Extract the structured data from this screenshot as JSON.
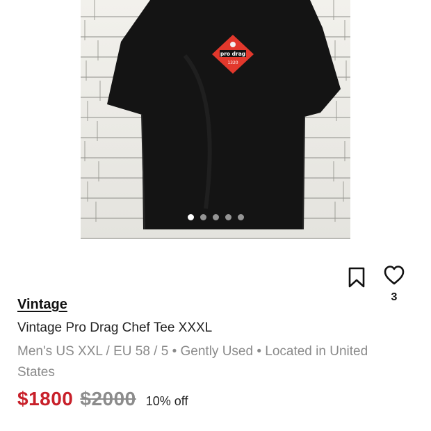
{
  "photo": {
    "patch_text_top": "pro drag",
    "patch_text_bottom": "1320",
    "carousel_count": 5,
    "carousel_active": 1,
    "wall_color": "#e9e8e3",
    "shirt_color": "#141414",
    "patch_color": "#e2382c"
  },
  "actions": {
    "bookmark_icon": "bookmark-icon",
    "like_icon": "heart-icon",
    "like_count": "3"
  },
  "listing": {
    "brand": "Vintage",
    "title": "Vintage Pro Drag Chef Tee XXXL",
    "meta": "Men's US XXL / EU 58 / 5 • Gently Used • Located in United States",
    "price": "$1800",
    "original_price": "$2000",
    "discount": "10% off",
    "price_color": "#c8202a"
  }
}
